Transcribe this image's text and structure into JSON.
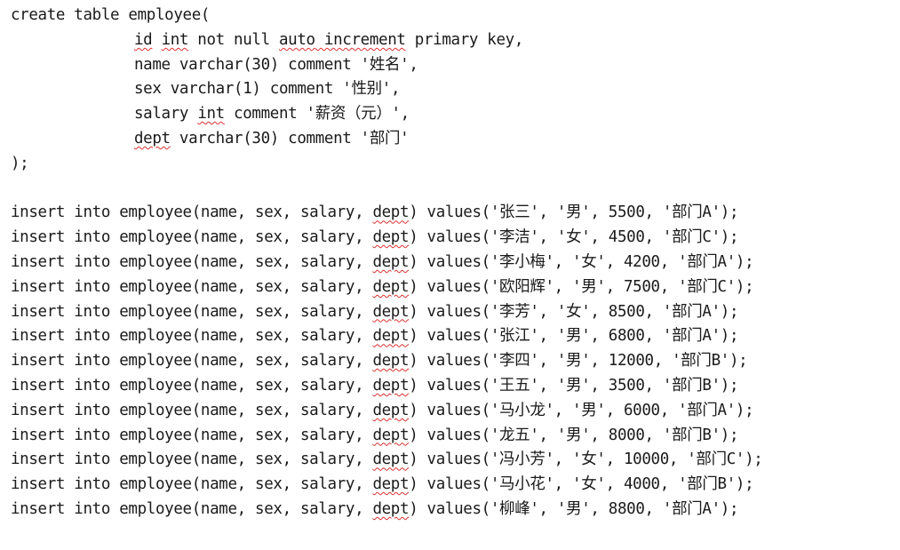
{
  "create_block": {
    "header": "create table employee(",
    "columns": [
      {
        "prefix": "",
        "flagged": "id",
        "mid": " ",
        "flagged2": "int",
        "rest": " not null ",
        "flagged3": "auto increment",
        "tail": " primary key,"
      },
      {
        "text": "name varchar(30) comment '姓名',"
      },
      {
        "text": "sex varchar(1) comment '性别',"
      },
      {
        "prefix": "salary ",
        "flagged": "int",
        "tail": " comment '薪资（元）',"
      },
      {
        "flagged": "dept",
        "tail": " varchar(30) comment '部门'"
      }
    ],
    "footer": ");"
  },
  "inserts": [
    {
      "pre": "insert into employee(name, sex, salary, ",
      "flagged": "dept",
      "post": ") values('张三', '男', 5500, '部门A');"
    },
    {
      "pre": "insert into employee(name, sex, salary, ",
      "flagged": "dept",
      "post": ") values('李洁', '女', 4500, '部门C');"
    },
    {
      "pre": "insert into employee(name, sex, salary, ",
      "flagged": "dept",
      "post": ") values('李小梅', '女', 4200, '部门A');"
    },
    {
      "pre": "insert into employee(name, sex, salary, ",
      "flagged": "dept",
      "post": ") values('欧阳辉', '男', 7500, '部门C');"
    },
    {
      "pre": "insert into employee(name, sex, salary, ",
      "flagged": "dept",
      "post": ") values('李芳', '女', 8500, '部门A');"
    },
    {
      "pre": "insert into employee(name, sex, salary, ",
      "flagged": "dept",
      "post": ") values('张江', '男', 6800, '部门A');"
    },
    {
      "pre": "insert into employee(name, sex, salary, ",
      "flagged": "dept",
      "post": ") values('李四', '男', 12000, '部门B');"
    },
    {
      "pre": "insert into employee(name, sex, salary, ",
      "flagged": "dept",
      "post": ") values('王五', '男', 3500, '部门B');"
    },
    {
      "pre": "insert into employee(name, sex, salary, ",
      "flagged": "dept",
      "post": ") values('马小龙', '男', 6000, '部门A');"
    },
    {
      "pre": "insert into employee(name, sex, salary, ",
      "flagged": "dept",
      "post": ") values('龙五', '男', 8000, '部门B');"
    },
    {
      "pre": "insert into employee(name, sex, salary, ",
      "flagged": "dept",
      "post": ") values('冯小芳', '女', 10000, '部门C');"
    },
    {
      "pre": "insert into employee(name, sex, salary, ",
      "flagged": "dept",
      "post": ") values('马小花', '女', 4000, '部门B');"
    },
    {
      "pre": "insert into employee(name, sex, salary, ",
      "flagged": "dept",
      "post": ") values('柳峰', '男', 8800, '部门A');"
    }
  ],
  "colors": {
    "text": "#1a1a1a",
    "spellcheck_underline": "#e03030",
    "background": "#ffffff"
  }
}
